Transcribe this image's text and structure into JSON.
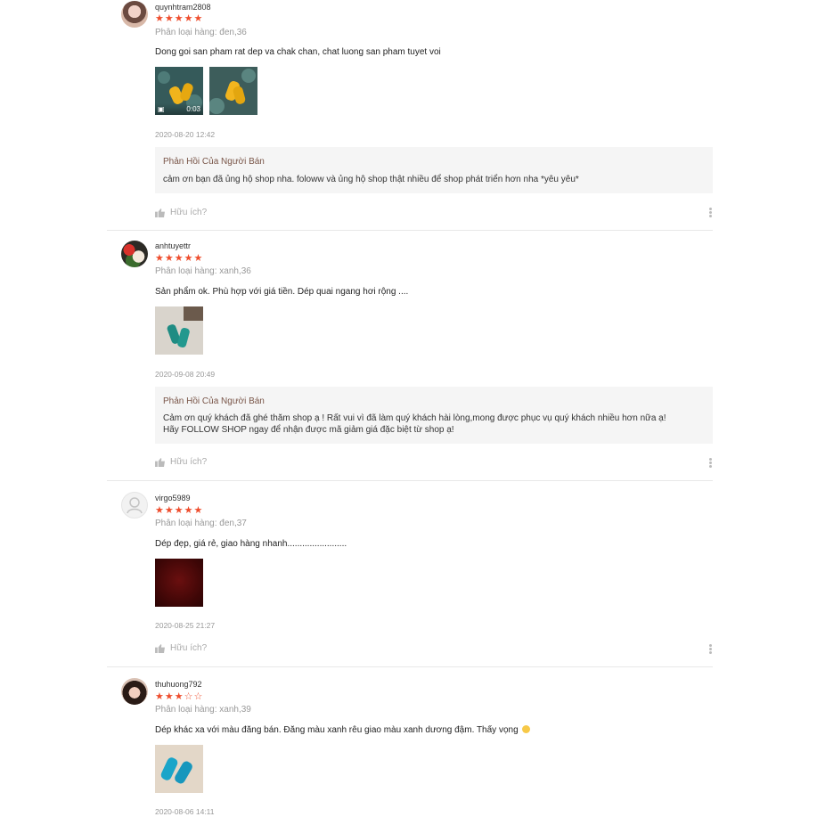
{
  "reviews": [
    {
      "username": "quynhtram2808",
      "stars": "★★★★★",
      "variant": "Phân loại hàng: đen,36",
      "comment": "Dong goi san pham rat dep va chak chan, chat luong san pham tuyet voi",
      "video_duration": "0:03",
      "date": "2020-08-20 12:42",
      "reply_title": "Phản Hồi Của Người Bán",
      "reply_lines": [
        "cảm ơn bạn đã ủng hộ shop nha. foloww và ủng hộ shop thật nhiều để shop phát triển hơn nha *yêu yêu*"
      ],
      "helpful": "Hữu ích?"
    },
    {
      "username": "anhtuyettr",
      "stars": "★★★★★",
      "variant": "Phân loại hàng: xanh,36",
      "comment": "Sản phẩm ok. Phù hợp với giá tiền. Dép quai ngang hơi rộng ....",
      "date": "2020-09-08 20:49",
      "reply_title": "Phản Hồi Của Người Bán",
      "reply_lines": [
        "Cảm ơn quý khách đã ghé thăm shop ạ ! Rất vui vì đã làm quý khách hài lòng,mong được phục vụ quý khách nhiều hơn nữa ạ!",
        "Hãy FOLLOW SHOP ngay để nhận được mã giảm giá đặc biệt từ shop ạ!"
      ],
      "helpful": "Hữu ích?"
    },
    {
      "username": "virgo5989",
      "stars": "★★★★★",
      "variant": "Phân loại hàng: đen,37",
      "comment": "Dép đẹp, giá rẻ, giao hàng nhanh........................",
      "date": "2020-08-25 21:27",
      "helpful": "Hữu ích?"
    },
    {
      "username": "thuhuong792",
      "stars_on": "★★★",
      "stars_off": "☆☆",
      "variant": "Phân loại hàng: xanh,39",
      "comment": "Dép khác xa với màu đăng bán. Đăng màu xanh rêu giao màu xanh dương đậm. Thấy vọng",
      "date": "2020-08-06 14:11"
    }
  ],
  "colors": {
    "star": "#ee4d2d",
    "reply_title": "#795548",
    "reply_bg": "#f5f5f5"
  }
}
